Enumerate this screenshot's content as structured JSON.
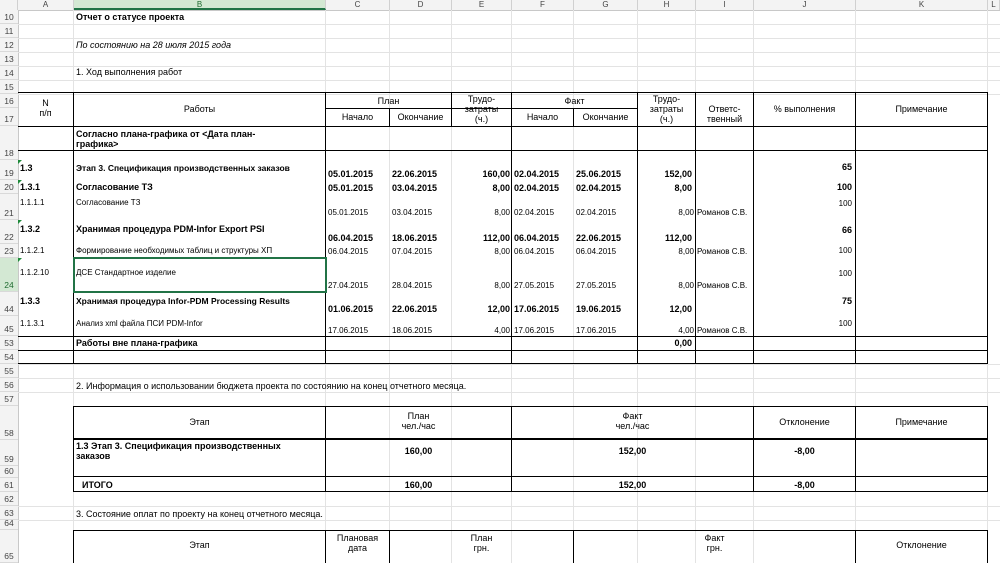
{
  "columns": [
    "A",
    "B",
    "C",
    "D",
    "E",
    "F",
    "G",
    "H",
    "I",
    "J",
    "K",
    "L"
  ],
  "rows": [
    "10",
    "11",
    "12",
    "13",
    "14",
    "15",
    "16",
    "17",
    "18",
    "19",
    "20",
    "21",
    "22",
    "23",
    "24",
    "44",
    "45",
    "53",
    "54",
    "55",
    "56",
    "57",
    "58",
    "59",
    "60",
    "61",
    "62",
    "63",
    "64",
    "65"
  ],
  "title": "Отчет о статусе проекта",
  "date_line": "По состоянию на 28 июля 2015 года",
  "section1": "1.    Ход выполнения работ",
  "t1_headers": {
    "num": "N\nп/п",
    "works": "Работы",
    "plan": "План",
    "plan_start": "Начало",
    "plan_end": "Окончание",
    "labor_plan": "Трудо-\nзатраты\n(ч.)",
    "fact": "Факт",
    "fact_start": "Начало",
    "fact_end": "Окончание",
    "labor_fact": "Трудо-\nзатраты\n(ч.)",
    "resp": "Ответс-\nтвенный",
    "pct": "% выполнения",
    "note": "Примечание"
  },
  "t1_group": "Согласно плана-графика от <Дата план-\nграфика>",
  "t1_rows": [
    {
      "num": "1.3",
      "work": "Этап 3. Спецификация производственных заказов",
      "ps": "05.01.2015",
      "pe": "22.06.2015",
      "lp": "160,00",
      "fs": "02.04.2015",
      "fe": "25.06.2015",
      "lf": "152,00",
      "resp": "",
      "pct": "65",
      "bold": true
    },
    {
      "num": "1.3.1",
      "work": "Согласование ТЗ",
      "ps": "05.01.2015",
      "pe": "03.04.2015",
      "lp": "8,00",
      "fs": "02.04.2015",
      "fe": "02.04.2015",
      "lf": "8,00",
      "resp": "",
      "pct": "100",
      "bold": true
    },
    {
      "num": "1.1.1.1",
      "work": "Согласование ТЗ",
      "ps": "05.01.2015",
      "pe": "03.04.2015",
      "lp": "8,00",
      "fs": "02.04.2015",
      "fe": "02.04.2015",
      "lf": "8,00",
      "resp": "Романов С.В.",
      "pct": "100",
      "bold": false
    },
    {
      "num": "1.3.2",
      "work": "Хранимая процедура PDM-Infor Export PSI",
      "ps": "06.04.2015",
      "pe": "18.06.2015",
      "lp": "112,00",
      "fs": "06.04.2015",
      "fe": "22.06.2015",
      "lf": "112,00",
      "resp": "",
      "pct": "66",
      "bold": true
    },
    {
      "num": "1.1.2.1",
      "work": "Формирование необходимых таблиц и структуры ХП",
      "ps": "06.04.2015",
      "pe": "07.04.2015",
      "lp": "8,00",
      "fs": "06.04.2015",
      "fe": "06.04.2015",
      "lf": "8,00",
      "resp": "Романов С.В.",
      "pct": "100",
      "bold": false
    },
    {
      "num": "1.1.2.10",
      "work": "ДСЕ Стандартное изделие",
      "ps": "27.04.2015",
      "pe": "28.04.2015",
      "lp": "8,00",
      "fs": "27.05.2015",
      "fe": "27.05.2015",
      "lf": "8,00",
      "resp": "Романов С.В.",
      "pct": "100",
      "bold": false
    },
    {
      "num": "1.3.3",
      "work": "Хранимая процедура Infor-PDM Processing Results",
      "ps": "01.06.2015",
      "pe": "22.06.2015",
      "lp": "12,00",
      "fs": "17.06.2015",
      "fe": "19.06.2015",
      "lf": "12,00",
      "resp": "",
      "pct": "75",
      "bold": true
    },
    {
      "num": "1.1.3.1",
      "work": "Анализ xml файла ПСИ PDM-Infor",
      "ps": "17.06.2015",
      "pe": "18.06.2015",
      "lp": "4,00",
      "fs": "17.06.2015",
      "fe": "17.06.2015",
      "lf": "4,00",
      "resp": "Романов С.В.",
      "pct": "100",
      "bold": false
    }
  ],
  "t1_outside": {
    "label": "Работы вне плана-графика",
    "lf": "0,00"
  },
  "section2": "2.    Информация о использовании бюджета проекта по состоянию на конец отчетного месяца.",
  "t2_headers": {
    "stage": "Этап",
    "plan": "План\nчел./час",
    "fact": "Факт\nчел./час",
    "dev": "Отклонение",
    "note": "Примечание"
  },
  "t2_row": {
    "stage": "1.3 Этап 3. Спецификация производственных\nзаказов",
    "plan": "160,00",
    "fact": "152,00",
    "dev": "-8,00"
  },
  "t2_total": {
    "label": "ИТОГО",
    "plan": "160,00",
    "fact": "152,00",
    "dev": "-8,00"
  },
  "section3": "3.    Состояние оплат по проекту на конец отчетного месяца.",
  "t3_headers": {
    "stage": "Этап",
    "plan_date": "Плановая\nдата",
    "plan": "План\nгрн.",
    "fact": "Факт\nгрн.",
    "dev": "Отклонение"
  }
}
